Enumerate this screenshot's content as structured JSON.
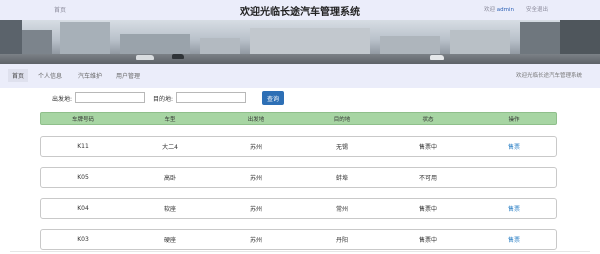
{
  "header": {
    "home_label": "首页",
    "title": "欢迎光临长途汽车管理系统",
    "welcome_prefix": "欢迎",
    "username": "admin",
    "logout_label": "安全退出"
  },
  "nav": {
    "tabs": [
      {
        "label": "首页",
        "active": true
      },
      {
        "label": "个人信息",
        "active": false
      },
      {
        "label": "汽车维护",
        "active": false
      },
      {
        "label": "用户管理",
        "active": false
      }
    ],
    "right_text": "欢迎光临长途汽车管理系统"
  },
  "search": {
    "departure_label": "出发地:",
    "departure_value": "",
    "destination_label": "目的地:",
    "destination_value": "",
    "button_label": "查询"
  },
  "table": {
    "columns": [
      "车牌号码",
      "车型",
      "出发地",
      "目的地",
      "状态",
      "操作"
    ],
    "rows": [
      {
        "plate": "K11",
        "model": "大二4",
        "from": "苏州",
        "to": "无锡",
        "status": "售票中",
        "action": "售票"
      },
      {
        "plate": "K05",
        "model": "高卧",
        "from": "苏州",
        "to": "蚌埠",
        "status": "不可用",
        "action": ""
      },
      {
        "plate": "K04",
        "model": "软座",
        "from": "苏州",
        "to": "常州",
        "status": "售票中",
        "action": "售票"
      },
      {
        "plate": "K03",
        "model": "硬座",
        "from": "苏州",
        "to": "丹阳",
        "status": "售票中",
        "action": "售票"
      }
    ]
  },
  "colors": {
    "header_bg": "#ebedfa",
    "table_header_bg": "#a7d5a3",
    "button_bg": "#2d6fb5",
    "action_link": "#2f82c6"
  }
}
